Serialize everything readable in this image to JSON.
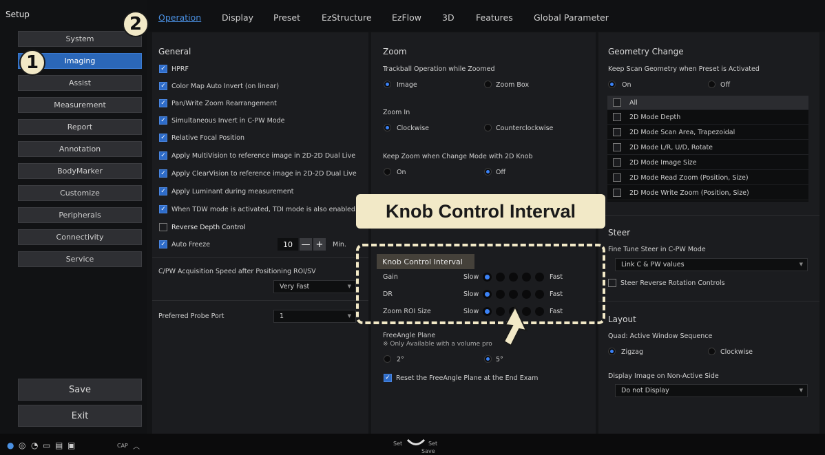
{
  "sidebar": {
    "title": "Setup",
    "items": [
      "System",
      "Imaging",
      "Assist",
      "Measurement",
      "Report",
      "Annotation",
      "BodyMarker",
      "Customize",
      "Peripherals",
      "Connectivity",
      "Service"
    ],
    "active": "Imaging",
    "save_label": "Save",
    "exit_label": "Exit"
  },
  "tabs": [
    "Operation",
    "Display",
    "Preset",
    "EzStructure",
    "EzFlow",
    "3D",
    "Features",
    "Global Parameter"
  ],
  "active_tab": "Operation",
  "callouts": {
    "one": "1",
    "two": "2",
    "banner": "Knob Control Interval"
  },
  "general": {
    "title": "General",
    "options": [
      {
        "label": "HPRF",
        "checked": true
      },
      {
        "label": "Color Map Auto Invert (on linear)",
        "checked": true
      },
      {
        "label": "Pan/Write Zoom Rearrangement",
        "checked": true
      },
      {
        "label": "Simultaneous Invert in C-PW Mode",
        "checked": true
      },
      {
        "label": "Relative Focal Position",
        "checked": true
      },
      {
        "label": "Apply MultiVision to reference image in 2D-2D Dual Live",
        "checked": true
      },
      {
        "label": "Apply ClearVision to reference image in 2D-2D Dual Live",
        "checked": true
      },
      {
        "label": "Apply Luminant during measurement",
        "checked": true
      },
      {
        "label": "When TDW mode is activated, TDI mode is also enabled.",
        "checked": true
      },
      {
        "label": "Reverse Depth Control",
        "checked": false
      }
    ],
    "auto_freeze": {
      "label": "Auto Freeze",
      "value": "10",
      "minus": "—",
      "plus": "+",
      "unit": "Min."
    },
    "acq_speed_label": "C/PW Acquisition Speed after Positioning ROI/SV",
    "acq_speed_value": "Very Fast",
    "probe_port_label": "Preferred Probe Port",
    "probe_port_value": "1"
  },
  "zoom": {
    "title": "Zoom",
    "trackball_label": "Trackball Operation while Zoomed",
    "trackball_options": [
      "Image",
      "Zoom Box"
    ],
    "zoom_in_label": "Zoom In",
    "zoom_in_options": [
      "Clockwise",
      "Counterclockwise"
    ],
    "keep_zoom_label": "Keep Zoom when Change Mode with 2D Knob",
    "keep_zoom_options": [
      "On",
      "Off"
    ]
  },
  "knob": {
    "title": "Knob Control Interval",
    "rows": [
      {
        "label": "Gain",
        "slow": "Slow",
        "fast": "Fast",
        "selected": 0
      },
      {
        "label": "DR",
        "slow": "Slow",
        "fast": "Fast",
        "selected": 0
      },
      {
        "label": "Zoom ROI Size",
        "slow": "Slow",
        "fast": "Fast",
        "selected": 0
      }
    ]
  },
  "freeangle": {
    "title": "FreeAngle Plane",
    "note": "※ Only Available with a volume pro",
    "options": [
      "2°",
      "5°"
    ],
    "reset_label": "Reset the FreeAngle Plane at the End Exam"
  },
  "geometry": {
    "title": "Geometry Change",
    "keep_label": "Keep Scan Geometry when Preset is Activated",
    "keep_options": [
      "On",
      "Off"
    ],
    "items": [
      "All",
      "2D Mode Depth",
      "2D Mode Scan Area, Trapezoidal",
      "2D Mode L/R, U/D, Rotate",
      "2D Mode Image Size",
      "2D Mode Read Zoom (Position, Size)",
      "2D Mode Write Zoom (Position, Size)"
    ]
  },
  "steer": {
    "title": "Steer",
    "fine_tune_label": "Fine Tune Steer in C-PW Mode",
    "fine_tune_value": "Link C & PW values",
    "reverse_label": "Steer Reverse Rotation Controls"
  },
  "layout": {
    "title": "Layout",
    "quad_label": "Quad: Active Window Sequence",
    "quad_options": [
      "Zigzag",
      "Clockwise"
    ],
    "display_label": "Display Image on Non-Active Side",
    "display_value": "Do not Display"
  },
  "bottom": {
    "cap": "CAP",
    "set_left": "Set",
    "set_right": "Set",
    "save": "Save"
  }
}
